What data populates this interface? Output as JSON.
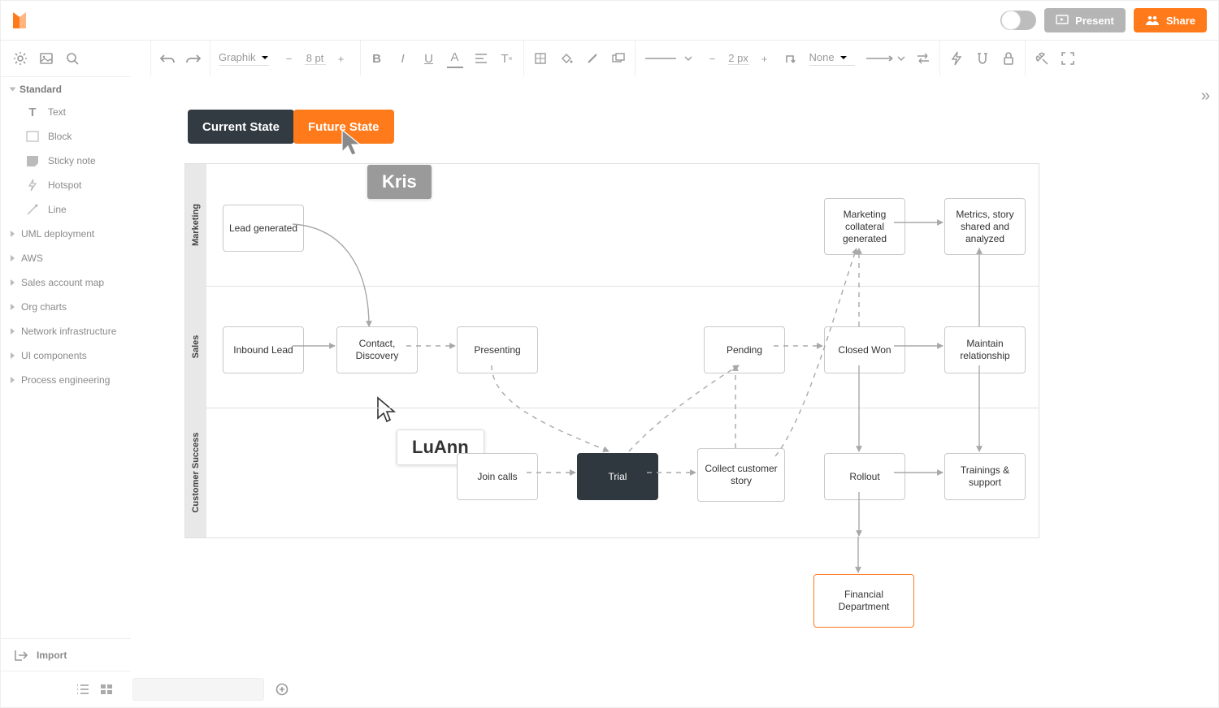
{
  "header": {
    "present_label": "Present",
    "share_label": "Share"
  },
  "toolbar": {
    "font_family": "Graphik",
    "font_size": "8 pt",
    "stroke_width": "2 px",
    "line_endpoint_label": "None"
  },
  "sidebar": {
    "standard_label": "Standard",
    "shapes": [
      "Text",
      "Block",
      "Sticky note",
      "Hotspot",
      "Line"
    ],
    "libraries": [
      "UML deployment",
      "AWS",
      "Sales account map",
      "Org charts",
      "Network infrastructure",
      "UI components",
      "Process engineering"
    ],
    "import_label": "Import"
  },
  "layers": {
    "current": "Current State",
    "future": "Future State"
  },
  "cursors": {
    "kris": "Kris",
    "luann": "LuAnn"
  },
  "swimlanes": {
    "lane1": "Marketing",
    "lane2": "Sales",
    "lane3": "Customer Success"
  },
  "nodes": {
    "lead_generated": "Lead generated",
    "marketing_collateral": "Marketing collateral generated",
    "metrics_story": "Metrics, story shared and analyzed",
    "inbound_lead": "Inbound Lead",
    "contact_discovery": "Contact, Discovery",
    "presenting": "Presenting",
    "pending": "Pending",
    "closed_won": "Closed Won",
    "maintain_relationship": "Maintain relationship",
    "join_calls": "Join calls",
    "trial": "Trial",
    "collect_story": "Collect customer story",
    "rollout": "Rollout",
    "trainings_support": "Trainings & support",
    "financial_dept": "Financial Department"
  }
}
